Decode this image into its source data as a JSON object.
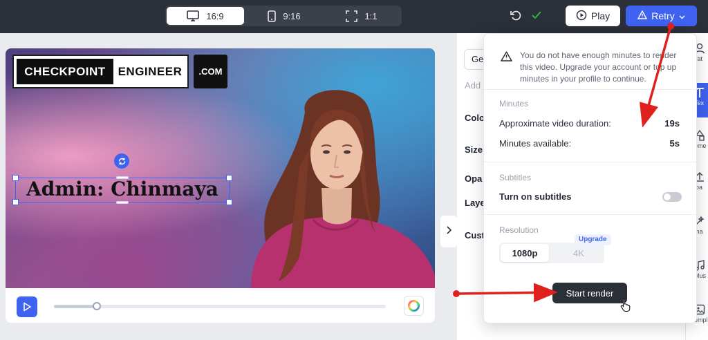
{
  "topbar": {
    "aspect_options": [
      {
        "label": "16:9",
        "icon": "monitor-icon",
        "active": true
      },
      {
        "label": "9:16",
        "icon": "phone-icon",
        "active": false
      },
      {
        "label": "1:1",
        "icon": "fullscreen-icon",
        "active": false
      }
    ],
    "play_label": "Play",
    "retry_label": "Retry"
  },
  "canvas": {
    "logo_left": "CHECKPOINT",
    "logo_right": "ENGINEER",
    "logo_com": ".COM",
    "title_text": "Admin: Chinmaya"
  },
  "player": {
    "progress_fraction": 0.13
  },
  "properties_panel": {
    "dropdown_value": "Ge",
    "hint": "Add",
    "labels": [
      "Colo",
      "Size",
      "Opa",
      "Laye",
      "Cust"
    ]
  },
  "right_rail": {
    "items": [
      {
        "label": "vat",
        "icon": "avatar-icon"
      },
      {
        "label": "Tex",
        "icon": "text-icon",
        "active": true
      },
      {
        "label": "eme",
        "icon": "elements-icon"
      },
      {
        "label": "loa",
        "icon": "upload-icon"
      },
      {
        "label": "ma",
        "icon": "magic-icon"
      },
      {
        "label": "Mus",
        "icon": "music-icon"
      },
      {
        "label": "empl",
        "icon": "templates-icon"
      }
    ]
  },
  "render_popup": {
    "warning": "You do not have enough minutes to render this video. Upgrade your account or top up minutes in your profile to continue.",
    "minutes_title": "Minutes",
    "duration_label": "Approximate video duration:",
    "duration_value": "19s",
    "available_label": "Minutes available:",
    "available_value": "5s",
    "subtitles_title": "Subtitles",
    "subtitles_label": "Turn on subtitles",
    "subtitles_on": false,
    "resolution_title": "Resolution",
    "resolution_options": [
      "1080p",
      "4K"
    ],
    "resolution_selected": "1080p",
    "upgrade_badge": "Upgrade",
    "start_label": "Start render"
  },
  "colors": {
    "accent": "#3f63f0",
    "topbar": "#2b2f38",
    "annotation_arrow": "#e0201c",
    "success_check": "#2fb344"
  }
}
